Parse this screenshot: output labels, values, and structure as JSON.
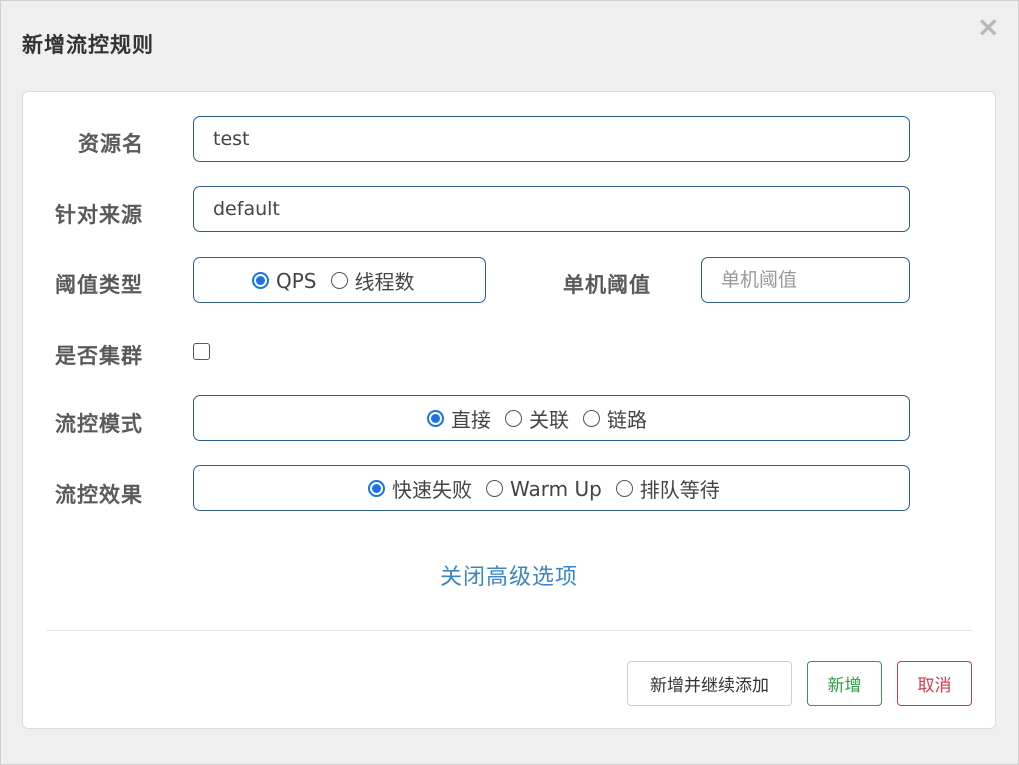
{
  "dialog": {
    "title": "新增流控规则",
    "close_label": "×"
  },
  "form": {
    "resource": {
      "label": "资源名",
      "value": "test"
    },
    "limit_app": {
      "label": "针对来源",
      "value": "default"
    },
    "grade": {
      "label": "阈值类型",
      "options": [
        "QPS",
        "线程数"
      ],
      "selected": "QPS"
    },
    "count": {
      "label": "单机阈值",
      "placeholder": "单机阈值",
      "value": ""
    },
    "cluster": {
      "label": "是否集群",
      "checked": false
    },
    "strategy": {
      "label": "流控模式",
      "options": [
        "直接",
        "关联",
        "链路"
      ],
      "selected": "直接"
    },
    "control_behavior": {
      "label": "流控效果",
      "options": [
        "快速失败",
        "Warm Up",
        "排队等待"
      ],
      "selected": "快速失败"
    },
    "advanced_toggle": "关闭高级选项"
  },
  "footer": {
    "save_continue_label": "新增并继续添加",
    "save_label": "新增",
    "cancel_label": "取消"
  },
  "colors": {
    "accent": "#1a73e8",
    "field_border": "#2f5c8a",
    "link": "#3a86c8",
    "success": "#2e9e46",
    "danger": "#d6394b"
  }
}
